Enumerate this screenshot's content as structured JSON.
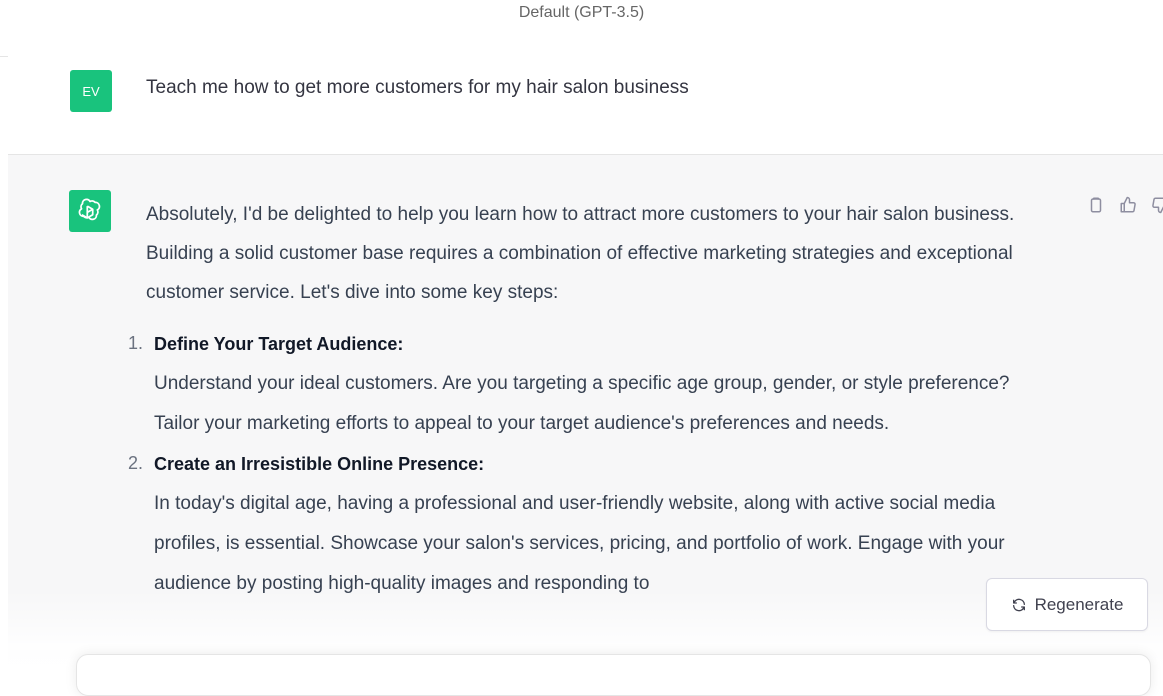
{
  "header": {
    "model_label": "Default (GPT-3.5)"
  },
  "conversation": {
    "user_message": {
      "avatar_initials": "EV",
      "text": "Teach me how to get more customers for my hair salon business"
    },
    "assistant_message": {
      "intro": "Absolutely, I'd be delighted to help you learn how to attract more customers to your hair salon business. Building a solid customer base requires a combination of effective marketing strategies and exceptional customer service. Let's dive into some key steps:",
      "steps": [
        {
          "number": "1.",
          "title": "Define Your Target Audience:",
          "body": "Understand your ideal customers. Are you targeting a specific age group, gender, or style preference? Tailor your marketing efforts to appeal to your target audience's preferences and needs."
        },
        {
          "number": "2.",
          "title": "Create an Irresistible Online Presence:",
          "body": "In today's digital age, having a professional and user-friendly website, along with active social media profiles, is essential. Showcase your salon's services, pricing, and portfolio of work. Engage with your audience by posting high-quality images and responding to"
        }
      ]
    }
  },
  "actions": {
    "regenerate_label": "Regenerate"
  },
  "colors": {
    "accent": "#19c37d",
    "assistant_bg": "#f7f7f8",
    "text": "#374151"
  },
  "icons": [
    "openai-logo-icon",
    "clipboard-icon",
    "thumbs-up-icon",
    "thumbs-down-icon",
    "regenerate-icon"
  ]
}
